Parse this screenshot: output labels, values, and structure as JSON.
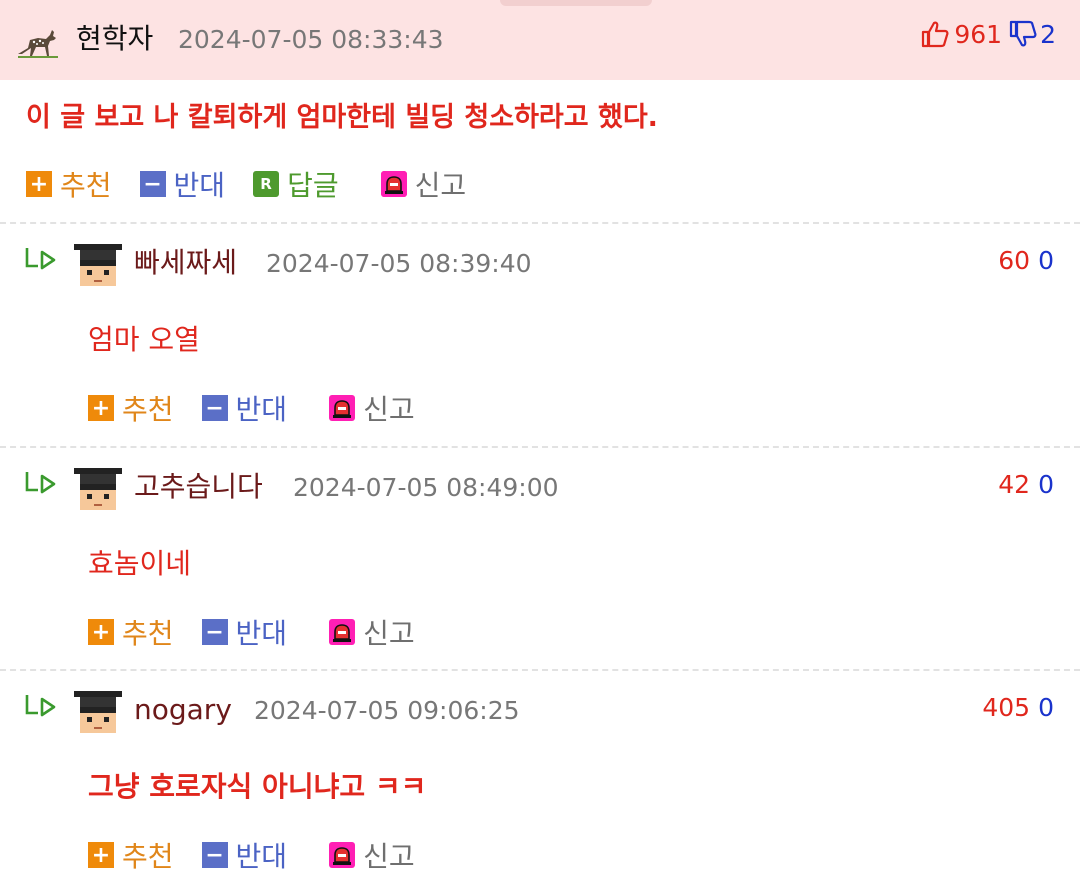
{
  "post": {
    "author": "현학자",
    "time": "2024-07-05 08:33:43",
    "up_count": "961",
    "down_count": "2",
    "body": "이 글 보고 나 칼퇴하게 엄마한테 빌딩 청소하라고 했다."
  },
  "actions": {
    "recommend": "추천",
    "oppose": "반대",
    "reply": "답글",
    "report": "신고",
    "reply_icon_letter": "R"
  },
  "comments": [
    {
      "author": "빠세짜세",
      "time": "2024-07-05 08:39:40",
      "up": "60",
      "down": "0",
      "text": "엄마 오열"
    },
    {
      "author": "고추습니다",
      "time": "2024-07-05 08:49:00",
      "up": "42",
      "down": "0",
      "text": "효놈이네"
    },
    {
      "author": "nogary",
      "time": "2024-07-05 09:06:25",
      "up": "405",
      "down": "0",
      "text": "그냥 호로자식 아니냐고 ㅋㅋ"
    }
  ],
  "colors": {
    "header_bg": "#fde3e3",
    "accent_red": "#e0271d",
    "down_blue": "#1a33cc"
  },
  "icons": [
    "deer-icon",
    "thumbs-up-icon",
    "thumbs-down-icon",
    "plus-icon",
    "minus-icon",
    "reply-r-icon",
    "siren-icon",
    "reply-arrow-icon",
    "student-avatar-icon"
  ]
}
